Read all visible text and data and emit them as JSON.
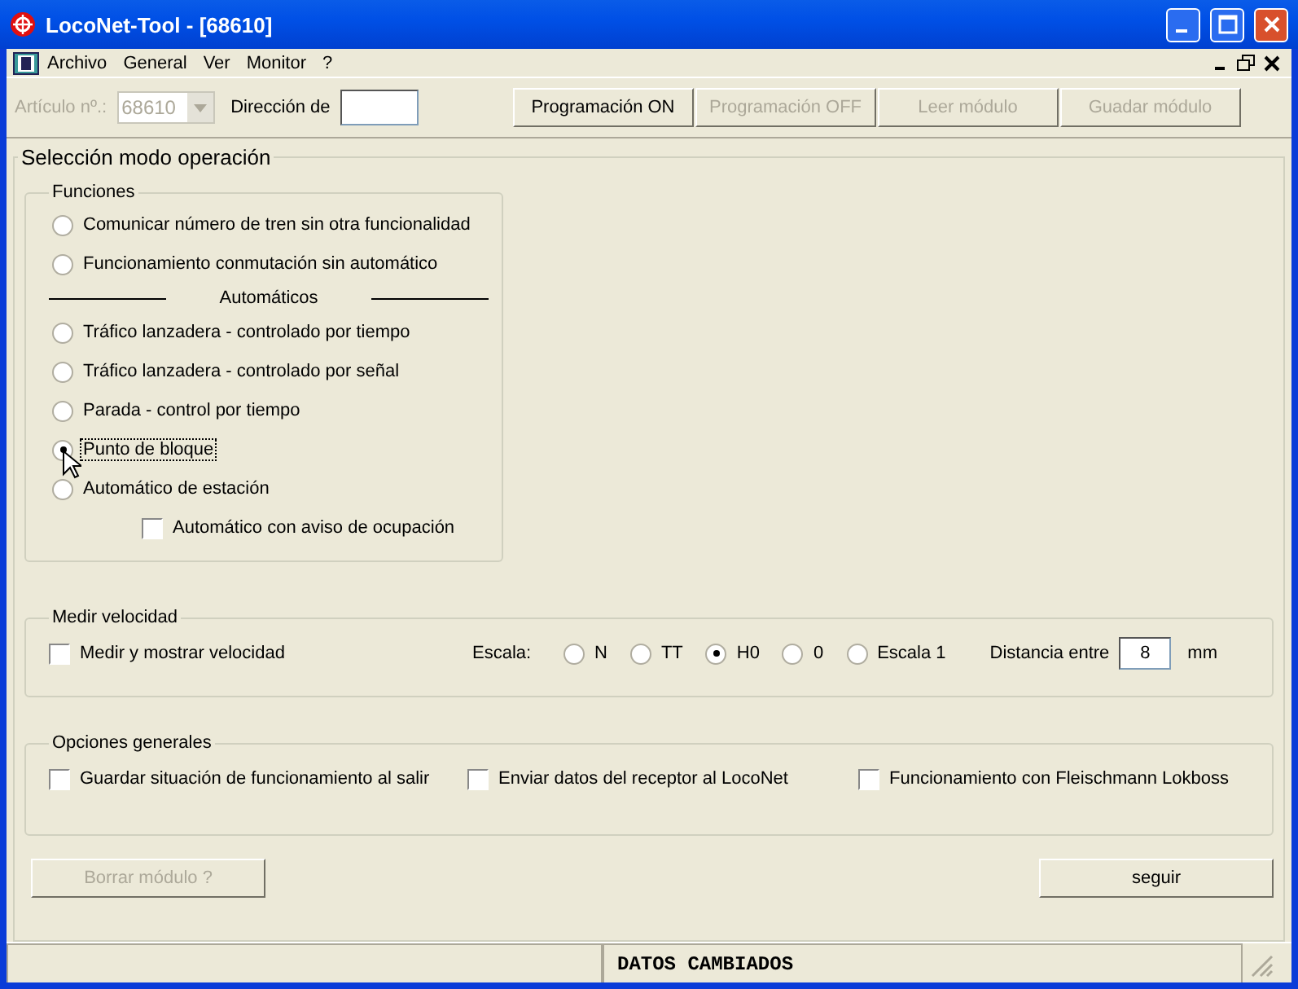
{
  "window": {
    "title": "LocoNet-Tool - [68610]"
  },
  "menu": [
    "Archivo",
    "General",
    "Ver",
    "Monitor",
    "?"
  ],
  "toolbar": {
    "article_label": "Artículo nº.:",
    "article_value": "68610",
    "article_disabled": true,
    "address_label": "Dirección de",
    "buttons": [
      {
        "label": "Programación ON",
        "disabled": false
      },
      {
        "label": "Programación OFF",
        "disabled": true
      },
      {
        "label": "Leer módulo",
        "disabled": true
      },
      {
        "label": "Guadar módulo",
        "disabled": true
      }
    ]
  },
  "main_group": {
    "title": "Selección modo operación",
    "funciones": {
      "title": "Funciones",
      "options": [
        {
          "kind": "radio",
          "label": "Comunicar número de tren sin otra funcionalidad",
          "selected": false,
          "focused": false
        },
        {
          "kind": "radio",
          "label": "Funcionamiento conmutación sin automático",
          "selected": false,
          "focused": false
        },
        {
          "kind": "separator",
          "label": "Automáticos"
        },
        {
          "kind": "radio",
          "label": "Tráfico lanzadera - controlado por tiempo",
          "selected": false,
          "focused": false
        },
        {
          "kind": "radio",
          "label": "Tráfico lanzadera - controlado por señal",
          "selected": false,
          "focused": false
        },
        {
          "kind": "radio",
          "label": "Parada - control por tiempo",
          "selected": false,
          "focused": false
        },
        {
          "kind": "radio",
          "label": "Punto de bloque",
          "selected": true,
          "focused": true
        },
        {
          "kind": "radio",
          "label": "Automático de estación",
          "selected": false,
          "focused": false
        },
        {
          "kind": "checkbox",
          "label": "Automático con aviso de ocupación",
          "checked": false
        }
      ]
    },
    "velocidad": {
      "title": "Medir velocidad",
      "checkbox": {
        "label": "Medir y mostrar velocidad",
        "checked": false
      },
      "scale_label": "Escala:",
      "scales": [
        {
          "label": "N",
          "selected": false
        },
        {
          "label": "TT",
          "selected": false
        },
        {
          "label": "H0",
          "selected": true
        },
        {
          "label": "0",
          "selected": false
        },
        {
          "label": "Escala 1",
          "selected": false
        }
      ],
      "distance_label": "Distancia entre",
      "distance_value": "8",
      "unit": "mm"
    },
    "opciones": {
      "title": "Opciones generales",
      "checkboxes": [
        {
          "label": "Guardar situación de funcionamiento al salir",
          "checked": false
        },
        {
          "label": "Enviar datos del receptor al LocoNet",
          "checked": false
        },
        {
          "label": "Funcionamiento con Fleischmann Lokboss",
          "checked": false
        }
      ]
    }
  },
  "bottom_buttons": [
    {
      "label": "Borrar módulo ?",
      "disabled": true
    },
    {
      "label": "seguir",
      "disabled": false
    }
  ],
  "status_bar": {
    "message": "DATOS CAMBIADOS"
  }
}
